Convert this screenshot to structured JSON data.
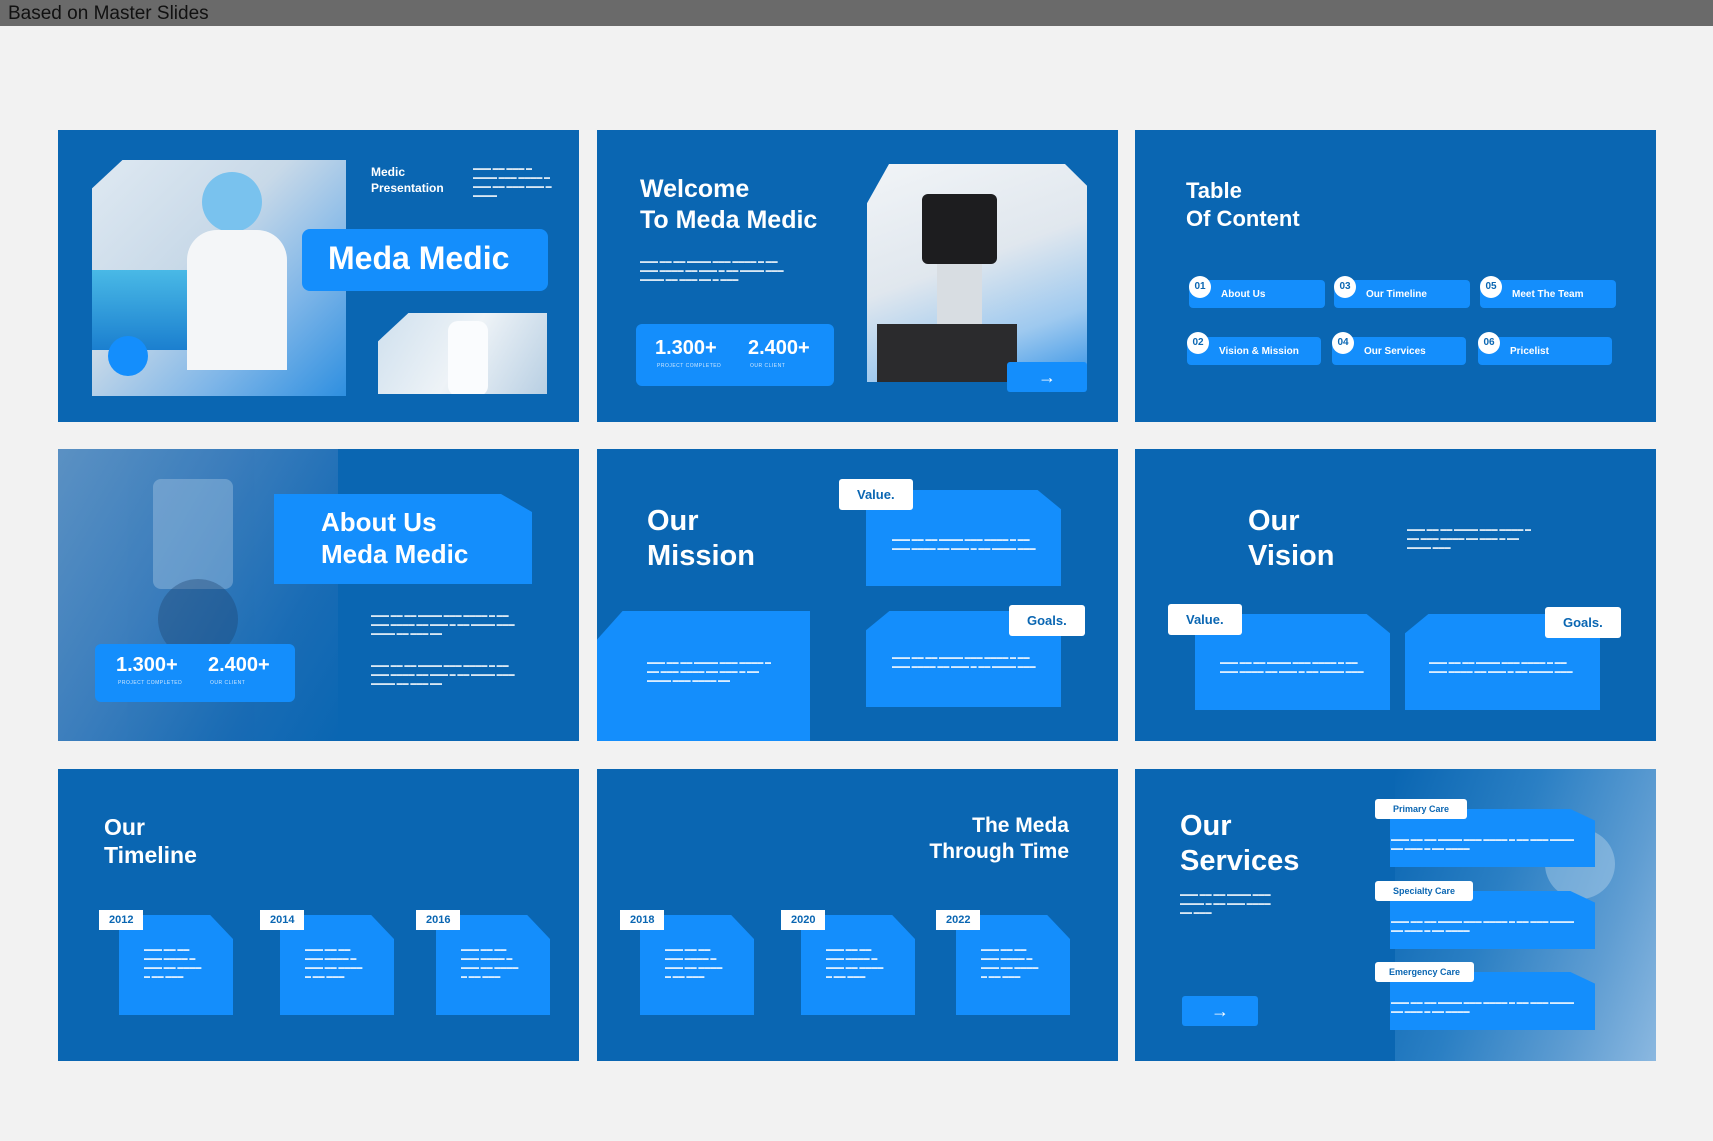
{
  "header": {
    "title": "Based on Master Slides"
  },
  "colors": {
    "slide_bg": "#0a66b2",
    "accent": "#148efc",
    "white": "#ffffff"
  },
  "slide1": {
    "medic_presentation": "Medic\nPresentation",
    "title": "Meda Medic"
  },
  "slide2": {
    "title": "Welcome\nTo Meda Medic",
    "stat1": "1.300+",
    "stat1_label": "PROJECT COMPLETED",
    "stat2": "2.400+",
    "stat2_label": "OUR CLIENT",
    "arrow": "→"
  },
  "slide3": {
    "title": "Table\nOf Content",
    "items": [
      {
        "num": "01",
        "label": "About Us"
      },
      {
        "num": "02",
        "label": "Vision & Mission"
      },
      {
        "num": "03",
        "label": "Our Timeline"
      },
      {
        "num": "04",
        "label": "Our Services"
      },
      {
        "num": "05",
        "label": "Meet The Team"
      },
      {
        "num": "06",
        "label": "Pricelist"
      }
    ]
  },
  "slide4": {
    "title": "About Us\nMeda Medic",
    "stat1": "1.300+",
    "stat1_label": "PROJECT COMPLETED",
    "stat2": "2.400+",
    "stat2_label": "OUR CLIENT"
  },
  "slide5": {
    "title": "Our\nMission",
    "tag_value": "Value.",
    "tag_goals": "Goals."
  },
  "slide6": {
    "title": "Our\nVision",
    "tag_value": "Value.",
    "tag_goals": "Goals."
  },
  "slide7": {
    "title": "Our\nTimeline",
    "years": [
      "2012",
      "2014",
      "2016"
    ]
  },
  "slide8": {
    "title": "The Meda\nThrough Time",
    "years": [
      "2018",
      "2020",
      "2022"
    ]
  },
  "slide9": {
    "title": "Our\nServices",
    "services": [
      "Primary Care",
      "Specialty Care",
      "Emergency Care"
    ],
    "arrow": "→"
  }
}
